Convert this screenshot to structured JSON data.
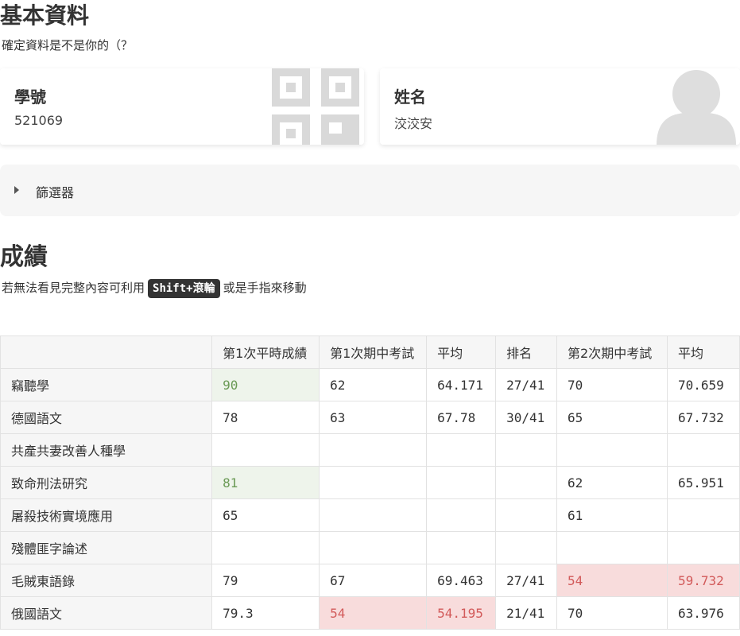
{
  "basic": {
    "title": "基本資料",
    "subtitle": "確定資料是不是你的（？",
    "student_id_label": "學號",
    "student_id_value": "521069",
    "name_label": "姓名",
    "name_value": "洨洨安"
  },
  "filter": {
    "label": "篩選器"
  },
  "grades": {
    "title": "成績",
    "hint_prefix": "若無法看見完整內容可利用",
    "hint_key": "Shift+滾輪",
    "hint_suffix": "或是手指來移動",
    "columns": [
      "",
      "第1次平時成績",
      "第1次期中考試",
      "平均",
      "排名",
      "第2次期中考試",
      "平均"
    ],
    "rows": [
      {
        "subject": "竊聽學",
        "cells": [
          "90",
          "62",
          "64.171",
          "27/41",
          "70",
          "70.659"
        ]
      },
      {
        "subject": "德國語文",
        "cells": [
          "78",
          "63",
          "67.78",
          "30/41",
          "65",
          "67.732"
        ]
      },
      {
        "subject": "共產共妻改善人種學",
        "cells": [
          "",
          "",
          "",
          "",
          "",
          ""
        ]
      },
      {
        "subject": "致命刑法研究",
        "cells": [
          "81",
          "",
          "",
          "",
          "62",
          "65.951"
        ]
      },
      {
        "subject": "屠殺技術實境應用",
        "cells": [
          "65",
          "",
          "",
          "",
          "61",
          ""
        ]
      },
      {
        "subject": "殘體匪字論述",
        "cells": [
          "",
          "",
          "",
          "",
          "",
          ""
        ]
      },
      {
        "subject": "毛賊東語錄",
        "cells": [
          "79",
          "67",
          "69.463",
          "27/41",
          "54",
          "59.732"
        ]
      },
      {
        "subject": "俄國語文",
        "cells": [
          "79.3",
          "54",
          "54.195",
          "21/41",
          "70",
          "63.976"
        ]
      }
    ]
  },
  "colors": {
    "good_bg": "#eef4eb",
    "good_text": "#6a9a55",
    "bad_bg": "#f8dcdc",
    "bad_text": "#d25a5a"
  }
}
